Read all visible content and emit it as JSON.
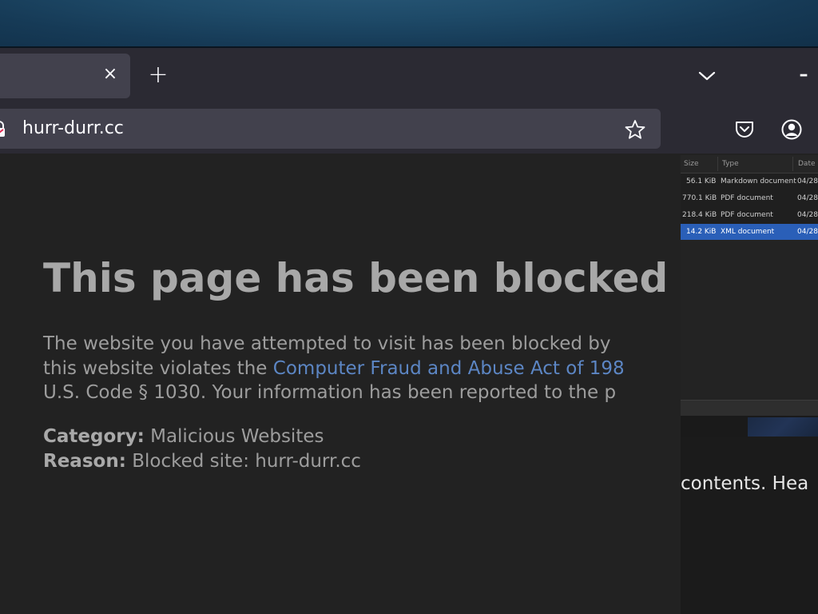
{
  "browser": {
    "tab_close_glyph": "×",
    "new_tab_glyph": "+",
    "minimize_glyph": "–",
    "url": "hurr-durr.cc"
  },
  "page": {
    "title": "This page has been blocked",
    "body_line1": "The website you have attempted to visit has been blocked by",
    "body_line2_prefix": "this website violates the ",
    "body_line2_link": "Computer Fraud and Abuse Act of 198",
    "body_line3": "U.S. Code § 1030. Your information has been reported to the p",
    "category_label": "Category:",
    "category_value": " Malicious Websites",
    "reason_label": "Reason:",
    "reason_value": " Blocked site: hurr-durr.cc"
  },
  "file_manager": {
    "columns": [
      "Size",
      "Type",
      "Date"
    ],
    "rows": [
      {
        "size": "56.1 KiB",
        "type": "Markdown document",
        "date": "04/28"
      },
      {
        "size": "770.1 KiB",
        "type": "PDF document",
        "date": "04/28"
      },
      {
        "size": "218.4 KiB",
        "type": "PDF document",
        "date": "04/28"
      },
      {
        "size": "14.2 KiB",
        "type": "XML document",
        "date": "04/28",
        "selected": true
      }
    ],
    "lower_text": "contents. Hea"
  },
  "colors": {
    "link": "#5c86c4",
    "selection": "#2a5fb8",
    "content_bg": "#222222"
  }
}
